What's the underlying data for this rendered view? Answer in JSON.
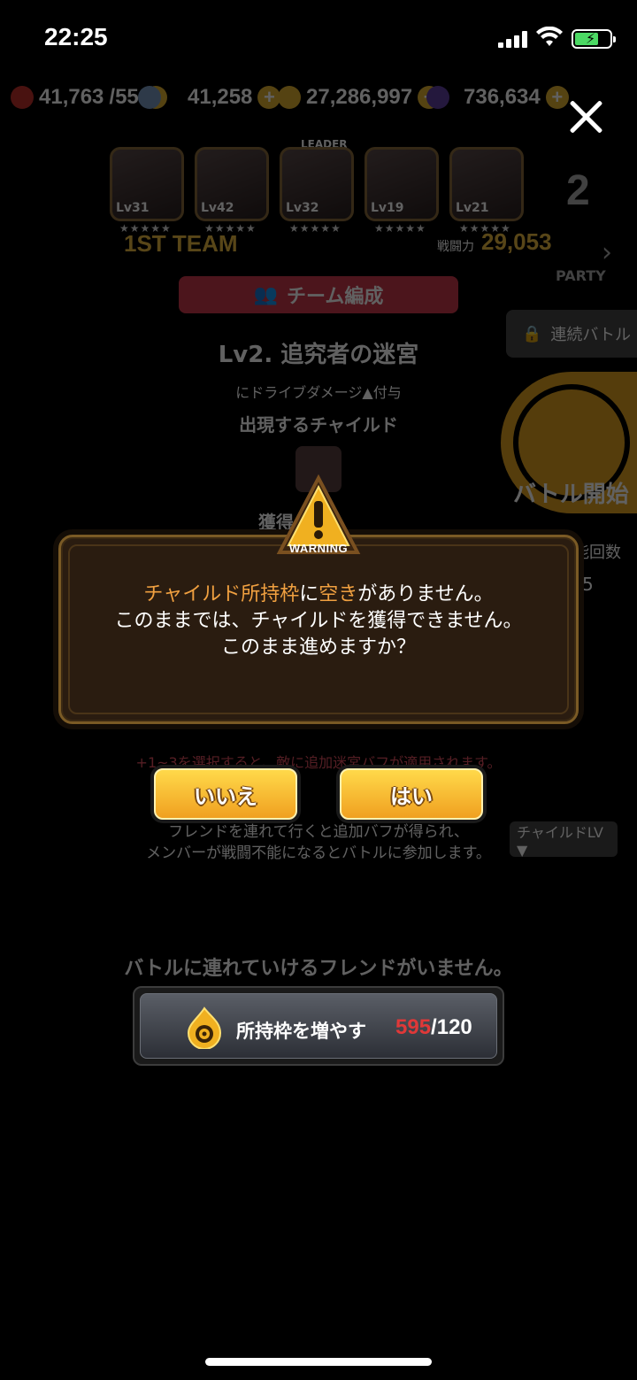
{
  "status_bar": {
    "time": "22:25"
  },
  "currency": {
    "stamina": "41,763",
    "stamina_max": "/55",
    "gems": "41,258",
    "gold": "27,286,997",
    "dark": "736,634"
  },
  "party": {
    "members": [
      {
        "lv": "Lv31"
      },
      {
        "lv": "Lv42"
      },
      {
        "lv": "Lv32"
      },
      {
        "lv": "Lv19"
      },
      {
        "lv": "Lv21"
      }
    ],
    "leader_tag": "LEADER",
    "stars": "★★★★★",
    "team_label": "1ST TEAM",
    "power_label": "戦闘力",
    "power_value": "29,053",
    "party_number": "2",
    "party_text": "PARTY"
  },
  "stage": {
    "team_edit": "チーム編成",
    "consecutive_battle": "連続バトル",
    "title": "Lv2. 追究者の迷宮",
    "subnote": "にドライブダメージ▲付与",
    "appear_label": "出現するチャイルド",
    "reward_label": "獲得",
    "battle_start": "バトル開始",
    "remaining_label": "能回数",
    "remaining_value": "5",
    "buff_note": "+1~3を選択すると、敵に追加迷宮バフが適用されます。",
    "friend_note_1": "フレンドを連れて行くと追加バフが得られ、",
    "friend_note_2": "メンバーが戦闘不能になるとバトルに参加します。",
    "child_lv_sort": "チャイルドLV ▼",
    "no_friend": "バトルに連れていけるフレンドがいません。"
  },
  "dialog": {
    "badge": "WARNING",
    "line1_a": "チャイルド所持枠",
    "line1_b": "に",
    "line1_c": "空き",
    "line1_d": "がありません。",
    "line2": "このままでは、チャイルドを獲得できません。",
    "line3": "このまま進めますか？",
    "no_label": "いいえ",
    "yes_label": "はい"
  },
  "capacity": {
    "label": "所持枠を増やす",
    "current": "595",
    "max": "/120"
  },
  "colors": {
    "accent_gold": "#e8b840",
    "button_gold": "#f0a020",
    "highlight_orange": "#f0a040",
    "over_capacity_red": "#e03838"
  }
}
